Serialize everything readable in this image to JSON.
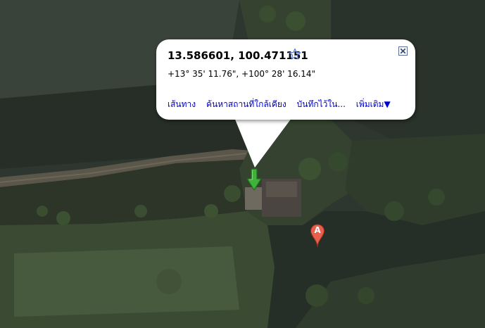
{
  "info_window": {
    "coordinates": "13.586601, 100.471151",
    "dms": "+13° 35' 11.76\", +100° 28' 16.14\"",
    "links": {
      "directions": "เส้นทาง",
      "search_nearby": "ค้นหาสถานที่ใกล้เคียง",
      "save_to": "บันทึกไว้ใน...",
      "more": "เพิ่มเติม▼"
    }
  },
  "markers": {
    "selected_marker": {
      "icon": "green-down-arrow-icon",
      "color": "#3fb23a"
    },
    "result_marker": {
      "label": "A",
      "icon": "red-pin-icon",
      "color": "#e8604c"
    }
  },
  "map_type": "satellite"
}
